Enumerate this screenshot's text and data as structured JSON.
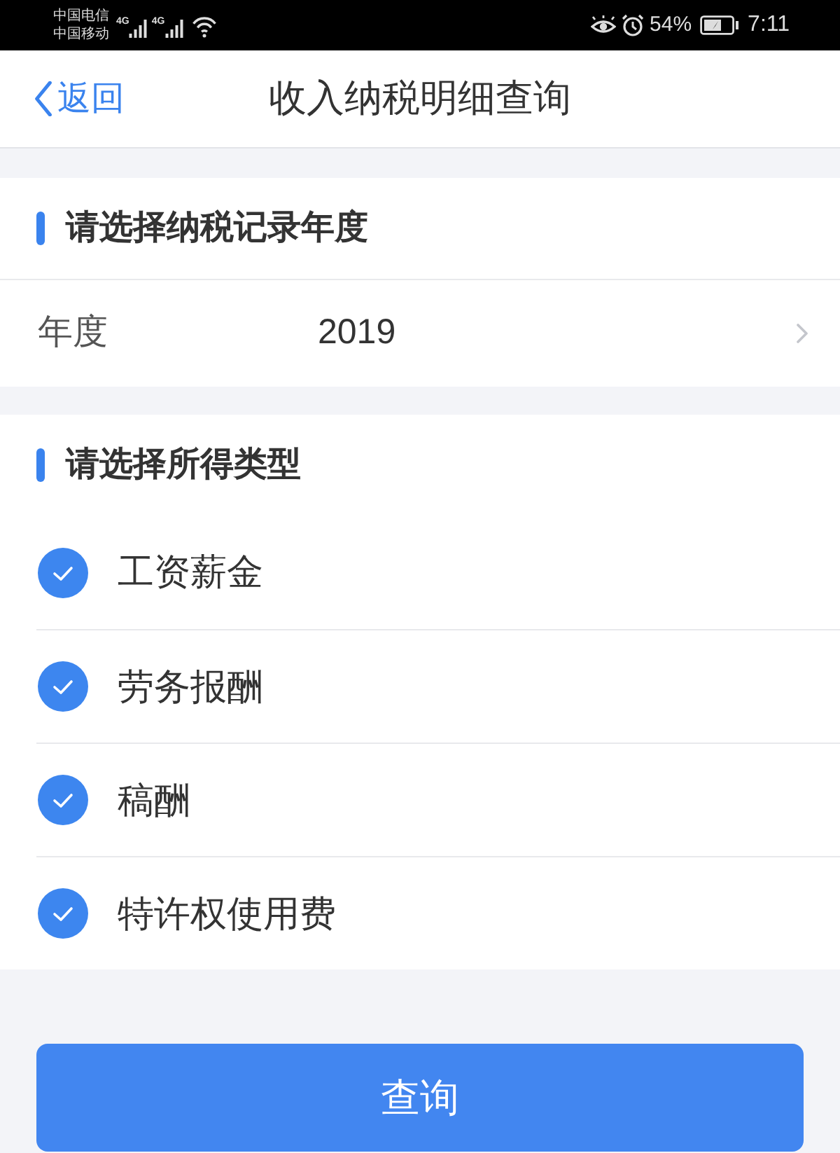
{
  "status_bar": {
    "carriers": [
      "中国电信",
      "中国移动"
    ],
    "signals": [
      {
        "network": "4G"
      },
      {
        "network": "4G"
      }
    ],
    "battery_percent": "54%",
    "time": "7:11"
  },
  "nav_bar": {
    "back_label": "返回",
    "title": "收入纳税明细查询"
  },
  "year_section": {
    "heading": "请选择纳税记录年度",
    "field": {
      "label": "年度",
      "value": "2019"
    }
  },
  "income_section": {
    "heading": "请选择所得类型",
    "options": [
      {
        "label": "工资薪金",
        "checked": true
      },
      {
        "label": "劳务报酬",
        "checked": true
      },
      {
        "label": "稿酬",
        "checked": true
      },
      {
        "label": "特许权使用费",
        "checked": true
      }
    ]
  },
  "query_button": {
    "label": "查询"
  }
}
